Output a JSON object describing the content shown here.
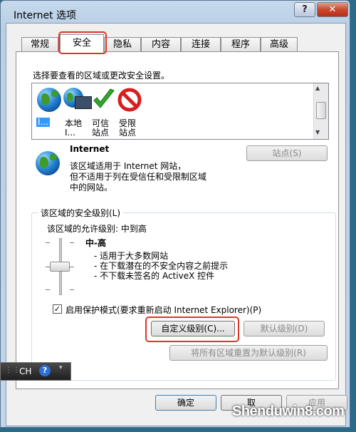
{
  "window": {
    "title": "Internet 选项",
    "help_glyph": "?",
    "close_glyph": "✕"
  },
  "tabs": [
    {
      "label": "常规"
    },
    {
      "label": "安全"
    },
    {
      "label": "隐私"
    },
    {
      "label": "内容"
    },
    {
      "label": "连接"
    },
    {
      "label": "程序"
    },
    {
      "label": "高级"
    }
  ],
  "security": {
    "instruction": "选择要查看的区域或更改安全设置。",
    "zones": [
      {
        "line1": "I...",
        "line2": ""
      },
      {
        "line1": "本地",
        "line2": "I..."
      },
      {
        "line1": "可信",
        "line2": "站点"
      },
      {
        "line1": "受限",
        "line2": "站点"
      }
    ],
    "zone_name": "Internet",
    "zone_desc1": "该区域适用于 Internet 网站，",
    "zone_desc2": "但不适用于列在受信任和受限制区域",
    "zone_desc3": "中的网站。",
    "sites_button": "站点(S)",
    "group_title": "该区域的安全级别(L)",
    "allowed_levels": "该区域的允许级别: 中到高",
    "level_name": "中-高",
    "level_bullets": [
      "- 适用于大多数网站",
      "- 在下载潜在的不安全内容之前提示",
      "- 不下载未签名的 ActiveX 控件"
    ],
    "protected_mode_label": "启用保护模式(要求重新启动 Internet Explorer)(P)",
    "protected_mode_checked": true,
    "custom_level_button": "自定义级别(C)...",
    "default_level_button": "默认级别(D)",
    "reset_all_button": "将所有区域重置为默认级别(R)"
  },
  "footer": {
    "ok": "确定",
    "cancel": "取",
    "apply": "应用"
  },
  "taskbar": {
    "lang": "CH",
    "help": "?"
  },
  "watermark": "Shenduwin8.com"
}
